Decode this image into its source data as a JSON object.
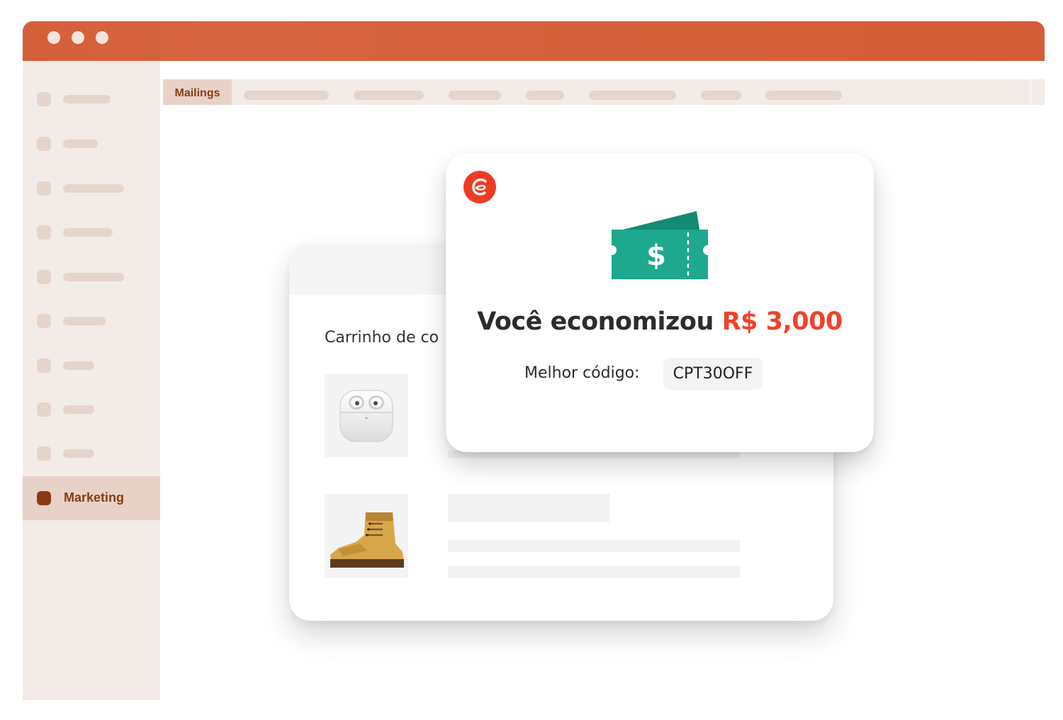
{
  "sidebar": {
    "active_item": {
      "label": "Marketing"
    },
    "placeholder_count": 9
  },
  "tabs": {
    "active_tab": {
      "label": "Mailings"
    },
    "placeholder_count": 7
  },
  "cart": {
    "title": "Carrinho de co",
    "items": [
      {
        "name": "earbuds"
      },
      {
        "name": "boot"
      }
    ]
  },
  "savings": {
    "headline_prefix": "Você economizou",
    "amount": "R$ 3,000",
    "ticket_symbol": "$",
    "code_label": "Melhor código:",
    "code_value": "CPT30OFF"
  },
  "colors": {
    "titlebar": "#d4603a",
    "sidebar_bg": "#f2ebe7",
    "active_accent": "#8a3a12",
    "amount": "#f2412a",
    "ticket": "#1ea88e",
    "logo": "#ef3b24"
  }
}
